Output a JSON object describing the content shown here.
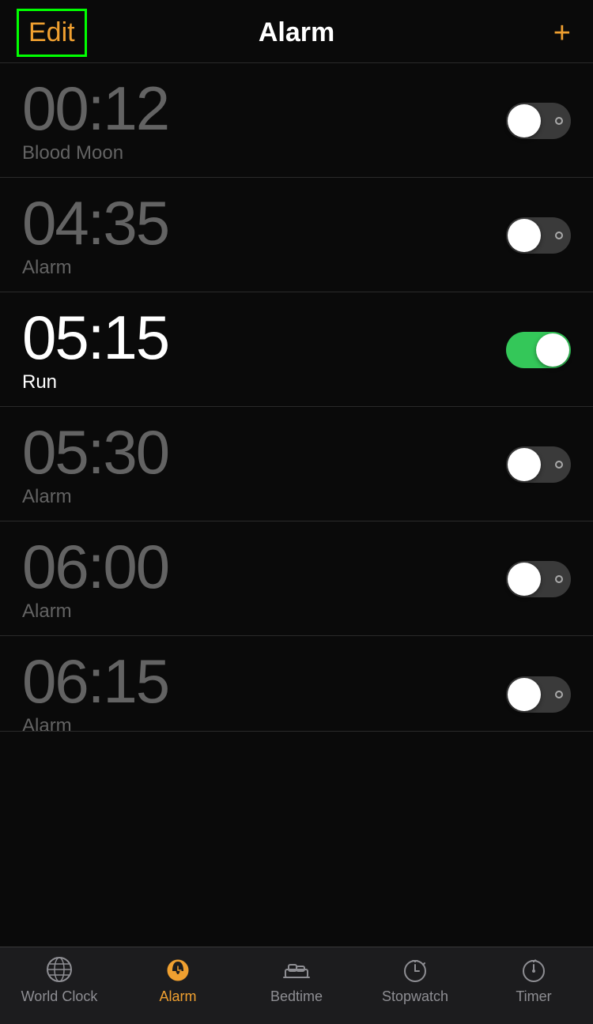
{
  "header": {
    "edit_label": "Edit",
    "title": "Alarm",
    "add_label": "+"
  },
  "alarms": [
    {
      "id": "alarm-1",
      "time": "00:12",
      "label": "Blood Moon",
      "active": false
    },
    {
      "id": "alarm-2",
      "time": "04:35",
      "label": "Alarm",
      "active": false
    },
    {
      "id": "alarm-3",
      "time": "05:15",
      "label": "Run",
      "active": true
    },
    {
      "id": "alarm-4",
      "time": "05:30",
      "label": "Alarm",
      "active": false
    },
    {
      "id": "alarm-5",
      "time": "06:00",
      "label": "Alarm",
      "active": false
    },
    {
      "id": "alarm-6",
      "time": "06:15",
      "label": "Alarm",
      "active": false
    }
  ],
  "tabs": [
    {
      "id": "world-clock",
      "label": "World Clock",
      "active": false
    },
    {
      "id": "alarm",
      "label": "Alarm",
      "active": true
    },
    {
      "id": "bedtime",
      "label": "Bedtime",
      "active": false
    },
    {
      "id": "stopwatch",
      "label": "Stopwatch",
      "active": false
    },
    {
      "id": "timer",
      "label": "Timer",
      "active": false
    }
  ],
  "colors": {
    "active_text": "#ffffff",
    "inactive_text": "#636363",
    "accent": "#f0a030",
    "toggle_on": "#34c759",
    "toggle_off": "#3a3a3a",
    "highlight_outline": "#00ff00"
  }
}
